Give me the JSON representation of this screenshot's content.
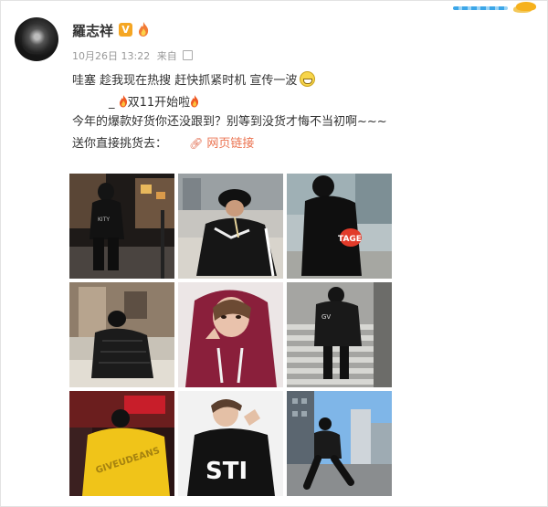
{
  "post": {
    "author": "羅志祥",
    "date": "10月26日",
    "time": "13:22",
    "source": "来自",
    "line1": "哇塞 趁我现在热搜 赶快抓紧时机 宣传一波",
    "line2_prefix": "_",
    "line2_text": "双11开始啦",
    "line3": "今年的爆款好货你还没跟到？别等到没货才悔不当初啊~~~",
    "line4_label": "送你直接挑货去：",
    "link_text": "网页链接"
  },
  "badges": {
    "verified": "V"
  },
  "photos": [
    {
      "name": "photo-street-night",
      "stamp": ""
    },
    {
      "name": "photo-bucket-hat-crouch",
      "stamp": ""
    },
    {
      "name": "photo-stage-sweater",
      "stamp": "TAGE"
    },
    {
      "name": "photo-puffer-jacket",
      "stamp": ""
    },
    {
      "name": "photo-red-hoodie",
      "stamp": ""
    },
    {
      "name": "photo-stairs",
      "stamp": ""
    },
    {
      "name": "photo-yellow-hoodie",
      "stamp": ""
    },
    {
      "name": "photo-white-bg-sweater",
      "stamp": ""
    },
    {
      "name": "photo-city-street",
      "stamp": ""
    }
  ],
  "colors": {
    "link": "#eb7350",
    "meta": "#999999",
    "text": "#333333",
    "verified": "#f5a623"
  },
  "icons": [
    "verified-icon",
    "fire-badge-icon",
    "grin-emoji-icon",
    "fire-emoji-icon",
    "link-icon",
    "edit-icon"
  ]
}
